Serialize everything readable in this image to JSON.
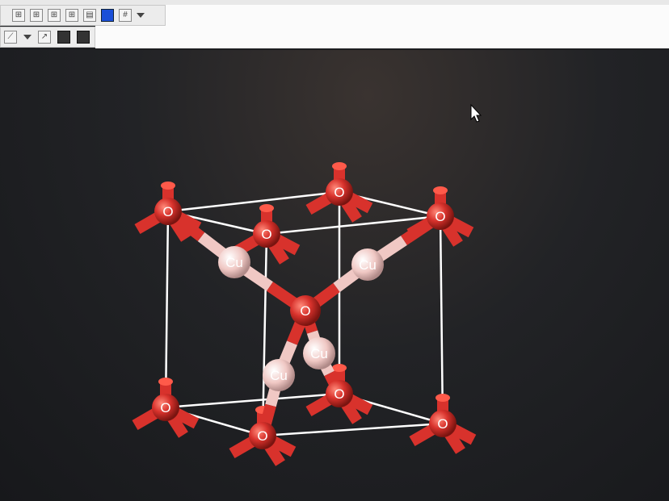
{
  "toolbar": {
    "row1": [
      "align-left-icon",
      "align-center-icon",
      "align-top-icon",
      "align-bottom-icon",
      "properties-icon",
      "color-icon",
      "grid-icon"
    ],
    "row2": [
      "measure-icon",
      "graph-icon",
      "library-icon",
      "library2-icon"
    ]
  },
  "viewer": {
    "atoms": [
      "O",
      "O",
      "O",
      "O",
      "O",
      "O",
      "O",
      "O",
      "O",
      "Cu",
      "Cu",
      "Cu",
      "Cu"
    ],
    "colors": {
      "oxygen": "#d8322c",
      "copper": "#f0c8c4",
      "cell": "#ffffff"
    }
  }
}
